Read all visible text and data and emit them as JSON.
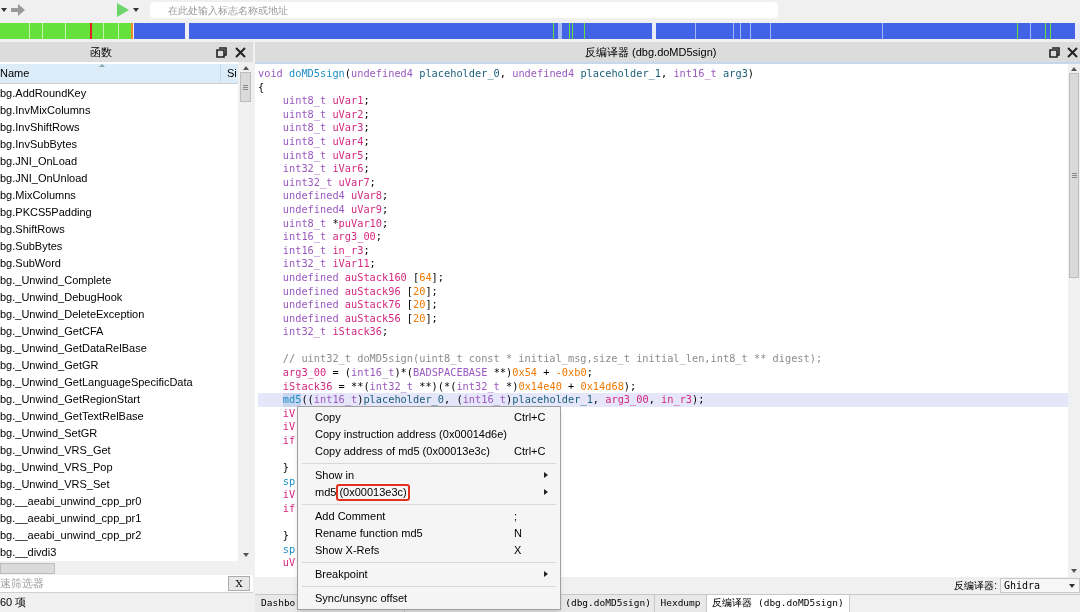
{
  "toolbar": {
    "search": {
      "placeholder": "在此处输入标志名称或地址"
    }
  },
  "functions_panel": {
    "title": "函数",
    "columns": [
      "Name",
      "Si"
    ],
    "rows": [
      "bg.AddRoundKey",
      "bg.InvMixColumns",
      "bg.InvShiftRows",
      "bg.InvSubBytes",
      "bg.JNI_OnLoad",
      "bg.JNI_OnUnload",
      "bg.MixColumns",
      "bg.PKCS5Padding",
      "bg.ShiftRows",
      "bg.SubBytes",
      "bg.SubWord",
      "bg._Unwind_Complete",
      "bg._Unwind_DebugHook",
      "bg._Unwind_DeleteException",
      "bg._Unwind_GetCFA",
      "bg._Unwind_GetDataRelBase",
      "bg._Unwind_GetGR",
      "bg._Unwind_GetLanguageSpecificData",
      "bg._Unwind_GetRegionStart",
      "bg._Unwind_GetTextRelBase",
      "bg._Unwind_SetGR",
      "bg._Unwind_VRS_Get",
      "bg._Unwind_VRS_Pop",
      "bg._Unwind_VRS_Set",
      "bg.__aeabi_unwind_cpp_pr0",
      "bg.__aeabi_unwind_cpp_pr1",
      "bg.__aeabi_unwind_cpp_pr2",
      "bg.__divdi3"
    ],
    "filter": {
      "placeholder": "速筛选器",
      "clear_button": "X"
    },
    "status": "60 项"
  },
  "decompiler_panel": {
    "title": "反编译器 (dbg.doMD5sign)",
    "lines": [
      {
        "kind": "top",
        "selected": false,
        "tokens": [
          {
            "kind": "type",
            "text": "void"
          },
          {
            "kind": "func",
            "text": " doMD5sign"
          },
          {
            "kind": "plain",
            "text": "("
          },
          {
            "kind": "type",
            "text": "undefined4"
          },
          {
            "kind": "param",
            "text": " placeholder_0"
          },
          {
            "kind": "plain",
            "text": ", "
          },
          {
            "kind": "type",
            "text": "undefined4"
          },
          {
            "kind": "param",
            "text": " placeholder_1"
          },
          {
            "kind": "plain",
            "text": ", "
          },
          {
            "kind": "type",
            "text": "int16_t"
          },
          {
            "kind": "param",
            "text": " arg3"
          },
          {
            "kind": "plain",
            "text": ")"
          }
        ]
      },
      {
        "kind": "top",
        "selected": false,
        "tokens": [
          {
            "kind": "plain",
            "text": "{"
          }
        ]
      },
      {
        "kind": "body",
        "selected": false,
        "tokens": [
          {
            "kind": "type",
            "text": "uint8_t"
          },
          {
            "kind": "local",
            "text": " uVar1"
          },
          {
            "kind": "plain",
            "text": ";"
          }
        ]
      },
      {
        "kind": "body",
        "selected": false,
        "tokens": [
          {
            "kind": "type",
            "text": "uint8_t"
          },
          {
            "kind": "local",
            "text": " uVar2"
          },
          {
            "kind": "plain",
            "text": ";"
          }
        ]
      },
      {
        "kind": "body",
        "selected": false,
        "tokens": [
          {
            "kind": "type",
            "text": "uint8_t"
          },
          {
            "kind": "local",
            "text": " uVar3"
          },
          {
            "kind": "plain",
            "text": ";"
          }
        ]
      },
      {
        "kind": "body",
        "selected": false,
        "tokens": [
          {
            "kind": "type",
            "text": "uint8_t"
          },
          {
            "kind": "local",
            "text": " uVar4"
          },
          {
            "kind": "plain",
            "text": ";"
          }
        ]
      },
      {
        "kind": "body",
        "selected": false,
        "tokens": [
          {
            "kind": "type",
            "text": "uint8_t"
          },
          {
            "kind": "local",
            "text": " uVar5"
          },
          {
            "kind": "plain",
            "text": ";"
          }
        ]
      },
      {
        "kind": "body",
        "selected": false,
        "tokens": [
          {
            "kind": "type",
            "text": "int32_t"
          },
          {
            "kind": "local",
            "text": " iVar6"
          },
          {
            "kind": "plain",
            "text": ";"
          }
        ]
      },
      {
        "kind": "body",
        "selected": false,
        "tokens": [
          {
            "kind": "type",
            "text": "uint32_t"
          },
          {
            "kind": "local",
            "text": " uVar7"
          },
          {
            "kind": "plain",
            "text": ";"
          }
        ]
      },
      {
        "kind": "body",
        "selected": false,
        "tokens": [
          {
            "kind": "type",
            "text": "undefined4"
          },
          {
            "kind": "local",
            "text": " uVar8"
          },
          {
            "kind": "plain",
            "text": ";"
          }
        ]
      },
      {
        "kind": "body",
        "selected": false,
        "tokens": [
          {
            "kind": "type",
            "text": "undefined4"
          },
          {
            "kind": "local",
            "text": " uVar9"
          },
          {
            "kind": "plain",
            "text": ";"
          }
        ]
      },
      {
        "kind": "body",
        "selected": false,
        "tokens": [
          {
            "kind": "type",
            "text": "uint8_t"
          },
          {
            "kind": "plain",
            "text": " *"
          },
          {
            "kind": "local",
            "text": "puVar10"
          },
          {
            "kind": "plain",
            "text": ";"
          }
        ]
      },
      {
        "kind": "body",
        "selected": false,
        "tokens": [
          {
            "kind": "type",
            "text": "int16_t"
          },
          {
            "kind": "local",
            "text": " arg3_00"
          },
          {
            "kind": "plain",
            "text": ";"
          }
        ]
      },
      {
        "kind": "body",
        "selected": false,
        "tokens": [
          {
            "kind": "type",
            "text": "int16_t"
          },
          {
            "kind": "local",
            "text": " in_r3"
          },
          {
            "kind": "plain",
            "text": ";"
          }
        ]
      },
      {
        "kind": "body",
        "selected": false,
        "tokens": [
          {
            "kind": "type",
            "text": "int32_t"
          },
          {
            "kind": "local",
            "text": " iVar11"
          },
          {
            "kind": "plain",
            "text": ";"
          }
        ]
      },
      {
        "kind": "body",
        "selected": false,
        "tokens": [
          {
            "kind": "type",
            "text": "undefined"
          },
          {
            "kind": "local",
            "text": " auStack160"
          },
          {
            "kind": "plain",
            "text": " ["
          },
          {
            "kind": "num",
            "text": "64"
          },
          {
            "kind": "plain",
            "text": "];"
          }
        ]
      },
      {
        "kind": "body",
        "selected": false,
        "tokens": [
          {
            "kind": "type",
            "text": "undefined"
          },
          {
            "kind": "local",
            "text": " auStack96"
          },
          {
            "kind": "plain",
            "text": " ["
          },
          {
            "kind": "num",
            "text": "20"
          },
          {
            "kind": "plain",
            "text": "];"
          }
        ]
      },
      {
        "kind": "body",
        "selected": false,
        "tokens": [
          {
            "kind": "type",
            "text": "undefined"
          },
          {
            "kind": "local",
            "text": " auStack76"
          },
          {
            "kind": "plain",
            "text": " ["
          },
          {
            "kind": "num",
            "text": "20"
          },
          {
            "kind": "plain",
            "text": "];"
          }
        ]
      },
      {
        "kind": "body",
        "selected": false,
        "tokens": [
          {
            "kind": "type",
            "text": "undefined"
          },
          {
            "kind": "local",
            "text": " auStack56"
          },
          {
            "kind": "plain",
            "text": " ["
          },
          {
            "kind": "num",
            "text": "20"
          },
          {
            "kind": "plain",
            "text": "];"
          }
        ]
      },
      {
        "kind": "body",
        "selected": false,
        "tokens": [
          {
            "kind": "type",
            "text": "int32_t"
          },
          {
            "kind": "local",
            "text": " iStack36"
          },
          {
            "kind": "plain",
            "text": ";"
          }
        ]
      },
      {
        "kind": "blank",
        "selected": false
      },
      {
        "kind": "body",
        "selected": false,
        "tokens": [
          {
            "kind": "comment",
            "text": "// uint32_t doMD5sign(uint8_t const * initial_msg,size_t initial_len,int8_t ** digest);"
          }
        ]
      },
      {
        "kind": "body",
        "selected": false,
        "tokens": [
          {
            "kind": "local",
            "text": "arg3_00"
          },
          {
            "kind": "plain",
            "text": " = ("
          },
          {
            "kind": "type",
            "text": "int16_t"
          },
          {
            "kind": "plain",
            "text": ")*("
          },
          {
            "kind": "type",
            "text": "BADSPACEBASE"
          },
          {
            "kind": "plain",
            "text": " **)"
          },
          {
            "kind": "num",
            "text": "0x54"
          },
          {
            "kind": "plain",
            "text": " + "
          },
          {
            "kind": "num",
            "text": "-0xb0"
          },
          {
            "kind": "plain",
            "text": ";"
          }
        ]
      },
      {
        "kind": "body",
        "selected": false,
        "tokens": [
          {
            "kind": "local",
            "text": "iStack36"
          },
          {
            "kind": "plain",
            "text": " = **("
          },
          {
            "kind": "type",
            "text": "int32_t"
          },
          {
            "kind": "plain",
            "text": " **)(*("
          },
          {
            "kind": "type",
            "text": "int32_t"
          },
          {
            "kind": "plain",
            "text": " *)"
          },
          {
            "kind": "num",
            "text": "0x14e40"
          },
          {
            "kind": "plain",
            "text": " + "
          },
          {
            "kind": "num",
            "text": "0x14d68"
          },
          {
            "kind": "plain",
            "text": ");"
          }
        ]
      },
      {
        "kind": "body",
        "selected": true,
        "tokens": [
          {
            "kind": "func",
            "text": "md5"
          },
          {
            "kind": "plain",
            "text": "(("
          },
          {
            "kind": "type",
            "text": "int16_t"
          },
          {
            "kind": "plain",
            "text": ")"
          },
          {
            "kind": "param",
            "text": "placeholder_0"
          },
          {
            "kind": "plain",
            "text": ", ("
          },
          {
            "kind": "type",
            "text": "int16_t"
          },
          {
            "kind": "plain",
            "text": ")"
          },
          {
            "kind": "param",
            "text": "placeholder_1"
          },
          {
            "kind": "plain",
            "text": ", "
          },
          {
            "kind": "local",
            "text": "arg3_00"
          },
          {
            "kind": "plain",
            "text": ", "
          },
          {
            "kind": "local",
            "text": "in_r3"
          },
          {
            "kind": "plain",
            "text": ");"
          }
        ]
      },
      {
        "kind": "body",
        "selected": false,
        "tokens": [
          {
            "kind": "local",
            "text": "iV"
          }
        ]
      },
      {
        "kind": "body",
        "selected": false,
        "tokens": [
          {
            "kind": "local",
            "text": "iV"
          }
        ]
      },
      {
        "kind": "body",
        "selected": false,
        "tokens": [
          {
            "kind": "keyword",
            "text": "if"
          }
        ]
      },
      {
        "kind": "blank",
        "selected": false
      },
      {
        "kind": "body",
        "selected": false,
        "tokens": [
          {
            "kind": "plain",
            "text": "}"
          }
        ]
      },
      {
        "kind": "body",
        "selected": false,
        "tokens": [
          {
            "kind": "func",
            "text": "sp"
          }
        ]
      },
      {
        "kind": "body",
        "selected": false,
        "tokens": [
          {
            "kind": "local",
            "text": "iV"
          }
        ]
      },
      {
        "kind": "body",
        "selected": false,
        "tokens": [
          {
            "kind": "keyword",
            "text": "if"
          }
        ]
      },
      {
        "kind": "blank",
        "selected": false
      },
      {
        "kind": "body",
        "selected": false,
        "tokens": [
          {
            "kind": "plain",
            "text": "}"
          }
        ]
      },
      {
        "kind": "body",
        "selected": false,
        "tokens": [
          {
            "kind": "func",
            "text": "sp"
          }
        ]
      },
      {
        "kind": "body",
        "selected": false,
        "tokens": [
          {
            "kind": "local",
            "text": "uV"
          }
        ]
      }
    ],
    "decompiler_selector": {
      "label": "反编译器:",
      "value": "Ghidra"
    }
  },
  "bottom_tabs": [
    {
      "label": "Dashbo",
      "selected": false
    },
    {
      "label": "(dbg.doMD5sign)",
      "selected": false
    },
    {
      "label": "Hexdump",
      "selected": false
    },
    {
      "label": "反编译器 (dbg.doMD5sign)",
      "selected": true
    }
  ],
  "context_menu": [
    {
      "kind": "item",
      "label": "Copy",
      "shortcut": "Ctrl+C"
    },
    {
      "kind": "item",
      "label": "Copy instruction address (0x00014d6e)"
    },
    {
      "kind": "item",
      "label": "Copy address of md5 (0x00013e3c)",
      "shortcut": "Ctrl+C"
    },
    {
      "kind": "separator"
    },
    {
      "kind": "submenu",
      "label": "Show in"
    },
    {
      "kind": "submenu",
      "label": "md5",
      "annotation": "(0x00013e3c)"
    },
    {
      "kind": "separator"
    },
    {
      "kind": "item",
      "label": "Add Comment",
      "shortcut": ";"
    },
    {
      "kind": "item",
      "label": "Rename function md5",
      "shortcut": "N"
    },
    {
      "kind": "item",
      "label": "Show X-Refs",
      "shortcut": "X"
    },
    {
      "kind": "separator"
    },
    {
      "kind": "submenu",
      "label": "Breakpoint"
    },
    {
      "kind": "separator"
    },
    {
      "kind": "item",
      "label": "Sync/unsync offset"
    }
  ]
}
